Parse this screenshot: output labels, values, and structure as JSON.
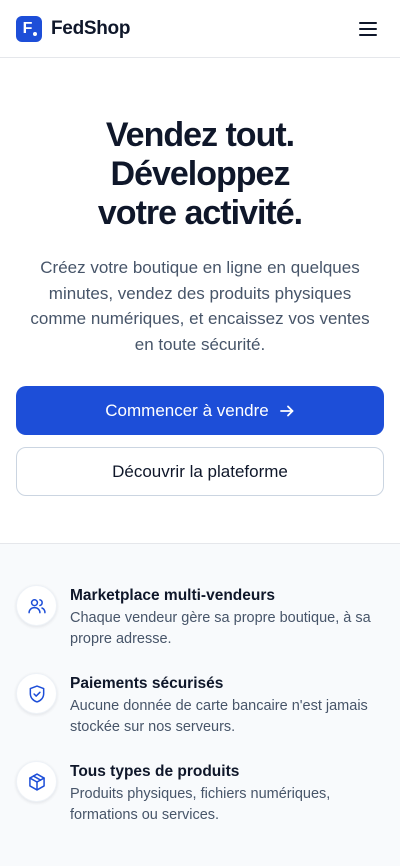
{
  "header": {
    "logo_letter": "F",
    "brand_name": "FedShop",
    "menu_icon": "hamburger-menu-icon"
  },
  "hero": {
    "title_lines": [
      "Vendez tout.",
      "Développez",
      "votre activité."
    ],
    "subtitle": "Créez votre boutique en ligne en quelques minutes, vendez des produits physiques comme numériques, et encaissez vos ventes en toute sécurité.",
    "primary_cta": "Commencer à vendre",
    "primary_cta_icon": "arrow-right-icon",
    "secondary_cta": "Découvrir la plateforme"
  },
  "features": [
    {
      "icon": "users-icon",
      "title": "Marketplace multi-vendeurs",
      "description": "Chaque vendeur gère sa propre boutique, à sa propre adresse."
    },
    {
      "icon": "shield-check-icon",
      "title": "Paiements sécurisés",
      "description": "Aucune donnée de carte bancaire n'est jamais stockée sur nos serveurs."
    },
    {
      "icon": "package-icon",
      "title": "Tous types de produits",
      "description": "Produits physiques, fichiers numériques, formations ou services."
    }
  ],
  "colors": {
    "accent": "#1d4ed8",
    "text_primary": "#0f172a",
    "text_secondary": "#475569",
    "features_background": "#f8fafc"
  }
}
